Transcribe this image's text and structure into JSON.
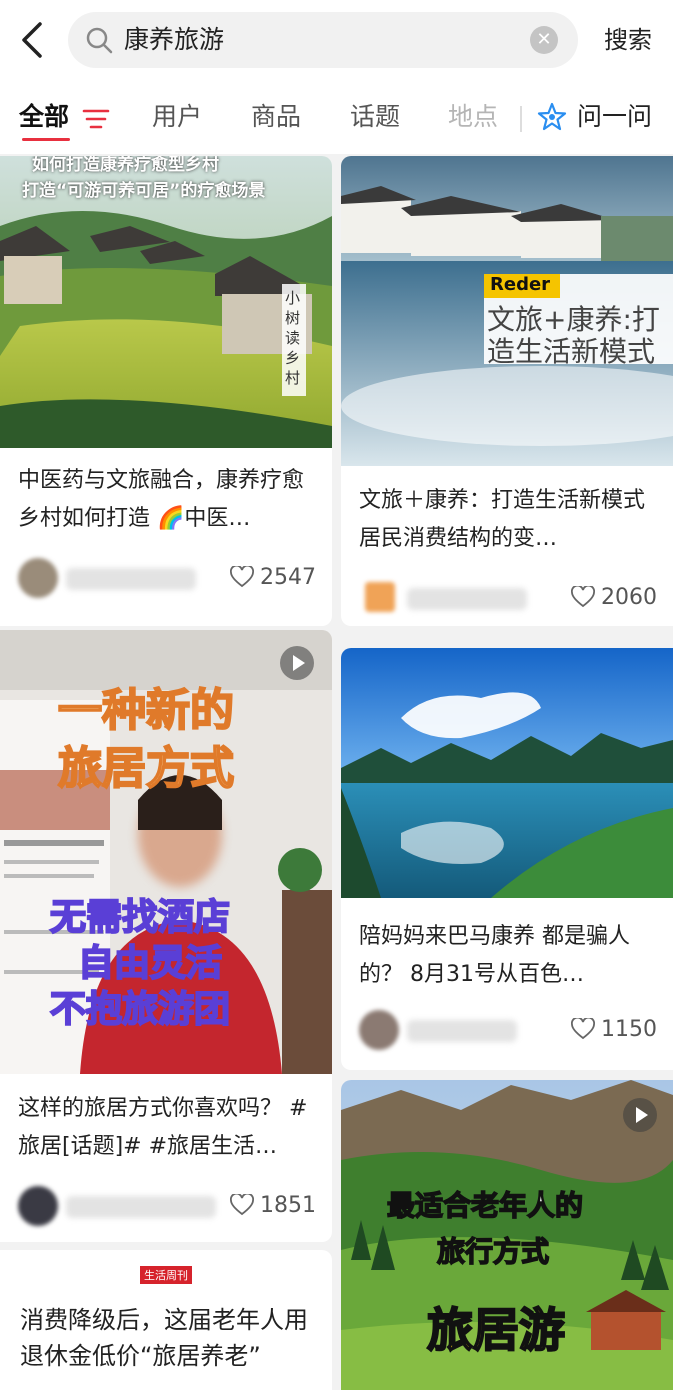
{
  "header": {
    "search_query": "康养旅游",
    "search_button": "搜索"
  },
  "tabs": [
    {
      "label": "全部"
    },
    {
      "label": "用户"
    },
    {
      "label": "商品"
    },
    {
      "label": "话题"
    },
    {
      "label": "地点"
    },
    {
      "label": "问一问"
    }
  ],
  "cards": [
    {
      "title": "中医药与文旅融合，康养疗愈乡村如何打造 🌈中医…",
      "likes": "2547",
      "image_text": [
        "如何打造康养疗愈型乡村",
        "打造“可游可养可居”的疗愈场景",
        "小树读乡村"
      ]
    },
    {
      "title": "文旅＋康养：打造生活新模式 居民消费结构的变…",
      "likes": "2060",
      "image_text": [
        "Reder",
        "文旅+康养:打",
        "造生活新模式"
      ]
    },
    {
      "title": "这样的旅居方式你喜欢吗？ #旅居[话题]# #旅居生活…",
      "likes": "1851",
      "image_text": [
        "一种新的",
        "旅居方式",
        "无需找酒店",
        "自由灵活",
        "不抱旅游团"
      ]
    },
    {
      "title": "陪妈妈来巴马康养 都是骗人的？ 8月31号从百色…",
      "likes": "1150",
      "image_text": []
    },
    {
      "title": "消费降级后，这届老年人用退休金低价“旅居养老”",
      "likes": "",
      "image_text": [
        "生活周刊"
      ]
    },
    {
      "title": "",
      "likes": "",
      "image_text": [
        "最适合老年人的",
        "旅行方式",
        "旅居游"
      ]
    }
  ]
}
